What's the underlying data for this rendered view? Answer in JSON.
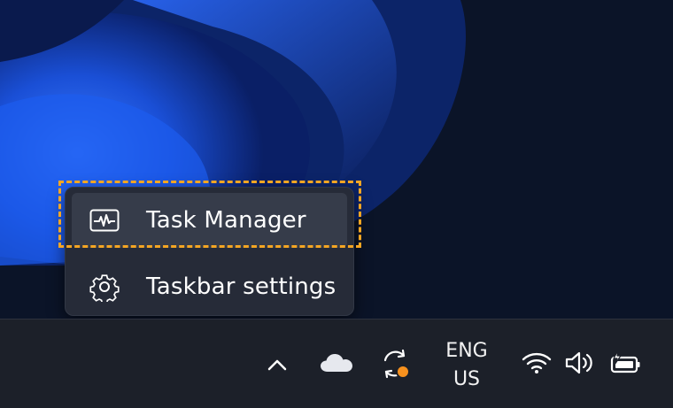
{
  "context_menu": {
    "items": [
      {
        "label": "Task Manager",
        "icon": "task-manager-icon",
        "highlighted": true
      },
      {
        "label": "Taskbar settings",
        "icon": "gear-icon",
        "highlighted": false
      }
    ]
  },
  "taskbar": {
    "tray": {
      "icons": [
        "chevron-up-icon",
        "onedrive-cloud-icon",
        "sync-icon",
        "wifi-icon",
        "volume-icon",
        "battery-charging-icon"
      ],
      "language": {
        "line1": "ENG",
        "line2": "US"
      }
    }
  },
  "colors": {
    "focus_outline": "#f5a623",
    "menu_background": "#262b38",
    "taskbar_background": "#1c2029",
    "sync_badge": "#f7911e"
  }
}
